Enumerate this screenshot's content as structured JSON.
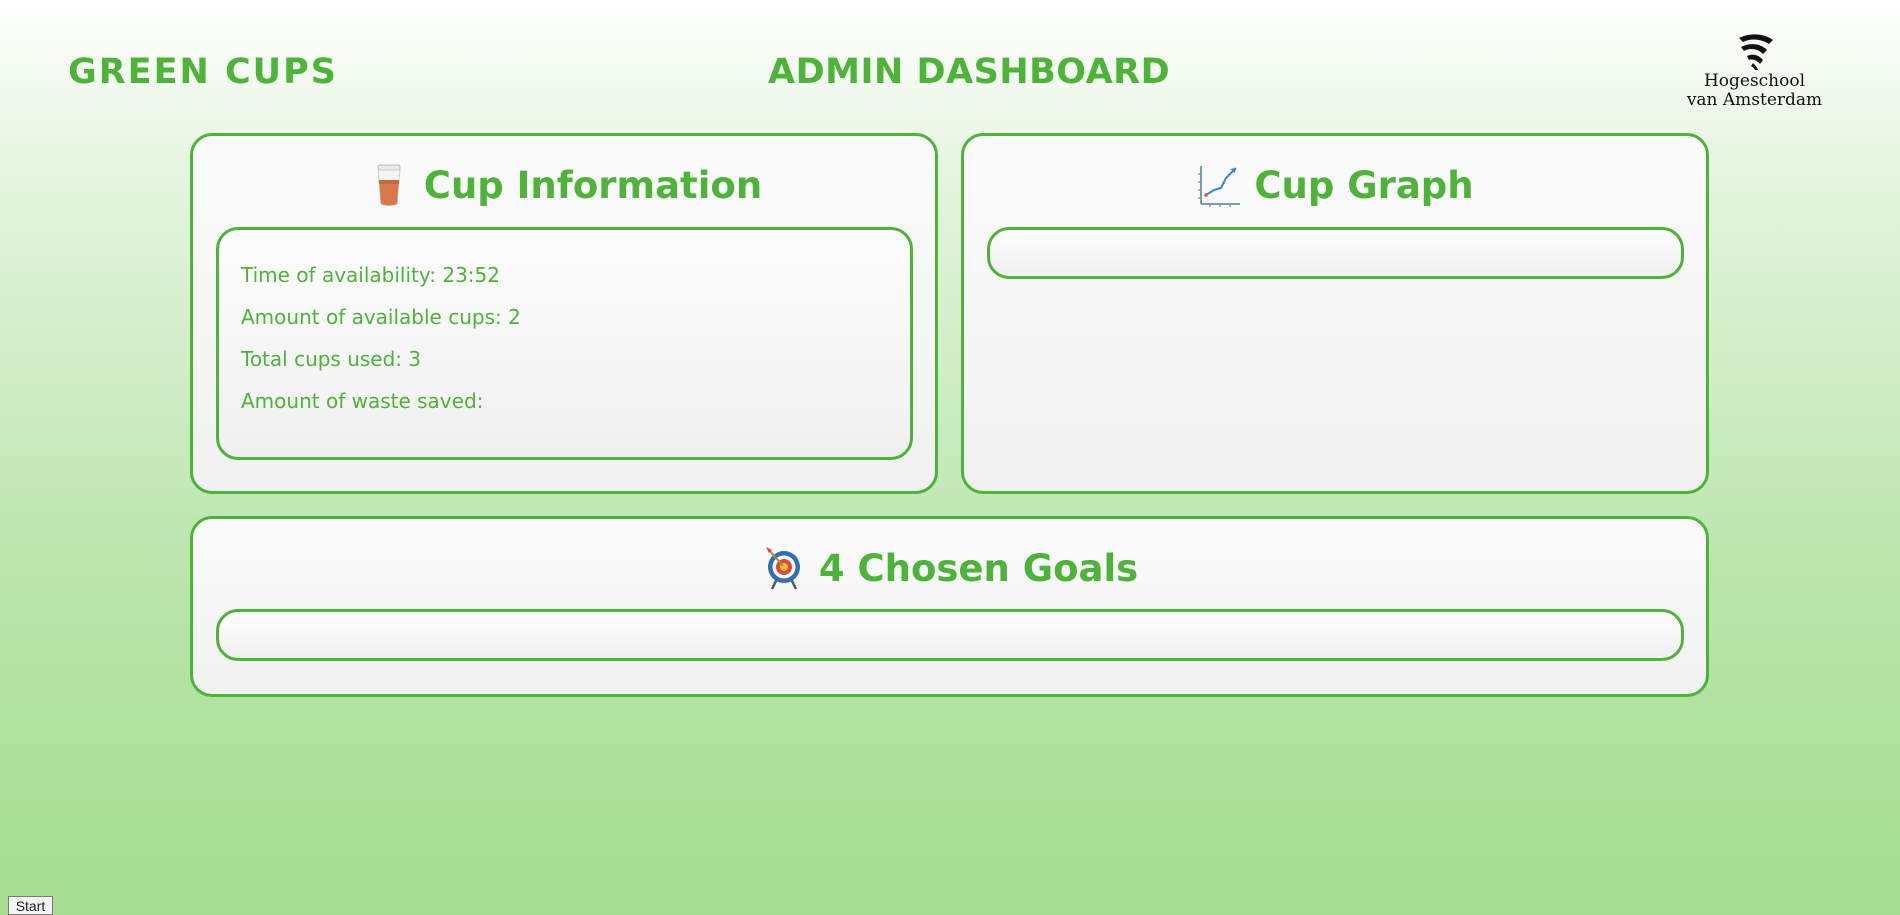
{
  "header": {
    "brand": "GREEN CUPS",
    "title": "ADMIN DASHBOARD",
    "logo": {
      "icon": "hva-logo-icon",
      "line1": "Hogeschool",
      "line2": "van Amsterdam"
    }
  },
  "cup_information": {
    "icon": "coffee-cup-icon",
    "title": "Cup Information",
    "lines": [
      "Time of availability: 23:52",
      "Amount of available cups: 2",
      "Total cups used: 3",
      "Amount of waste saved:"
    ]
  },
  "cup_graph": {
    "icon": "chart-increasing-icon",
    "title": "Cup Graph"
  },
  "goals": {
    "icon": "target-icon",
    "title": "4 Chosen Goals"
  },
  "footer": {
    "start_label": "Start"
  },
  "colors": {
    "accent": "#4db339",
    "background_top": "#ffffff",
    "background_bottom": "#a6de91"
  }
}
